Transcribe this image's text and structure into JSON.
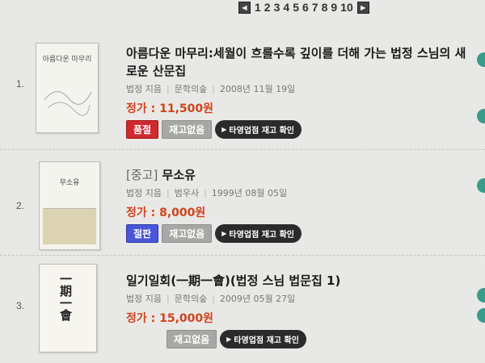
{
  "pagination": {
    "prev_icon": "prev-arrow-icon",
    "next_icon": "next-arrow-icon",
    "pages": [
      "1",
      "2",
      "3",
      "4",
      "5",
      "6",
      "7",
      "8",
      "9",
      "10"
    ]
  },
  "books": [
    {
      "index": "1.",
      "cover_text": "아름다운 마무리",
      "title": "아름다운 마무리:세월이 흐를수록 깊이를 더해 가는 법정 스님의 새로운 산문집",
      "author": "법정 지음",
      "publisher": "문학의숲",
      "date": "2008년 11월 19일",
      "price": "정가 : 11,500원",
      "status": "품절",
      "stock": "재고없음",
      "check": "타영업점 재고 확인"
    },
    {
      "index": "2.",
      "tag": "[중고]",
      "cover_text": "무소유",
      "title": "무소유",
      "author": "법정 지음",
      "publisher": "범우사",
      "date": "1999년 08월 05일",
      "price": "정가 : 8,000원",
      "status": "절판",
      "stock": "재고없음",
      "check": "타영업점 재고 확인"
    },
    {
      "index": "3.",
      "cover_text": "一期一會",
      "title": "일기일회(一期一會)(법정 스님 법문집 1)",
      "author": "법정 지음",
      "publisher": "문학의숲",
      "date": "2009년 05월 27일",
      "price": "정가 : 15,000원",
      "stock": "재고없음",
      "check": "타영업점 재고 확인"
    }
  ]
}
